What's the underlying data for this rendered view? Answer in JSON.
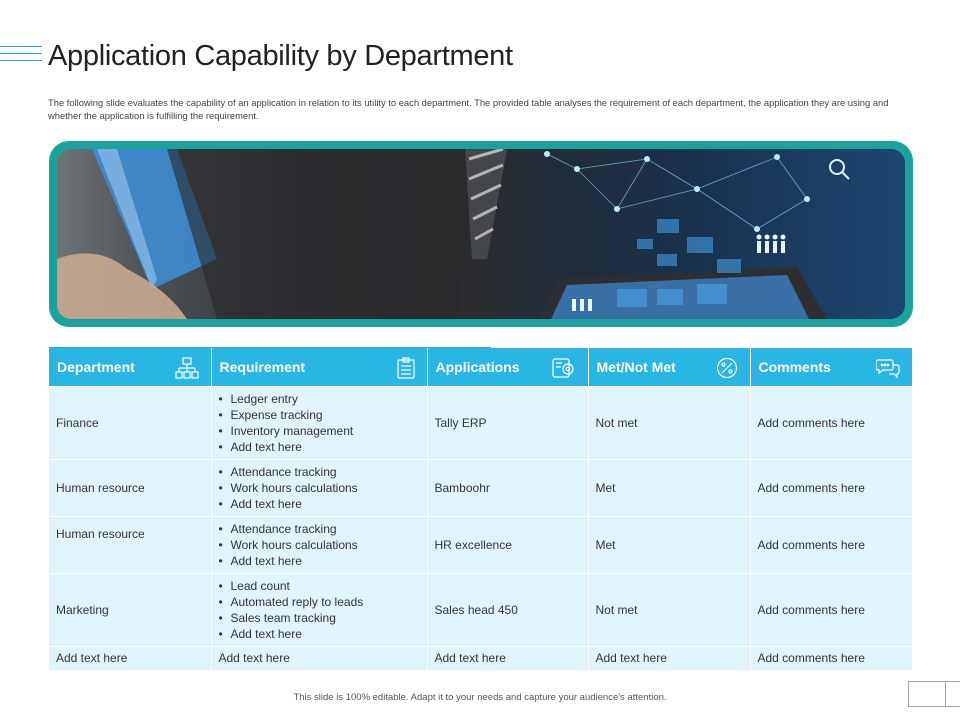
{
  "slide": {
    "title": "Application Capability by Department",
    "description": "The following slide evaluates the capability of an application in relation to its utility to each department. The provided table analyses the requirement of each department, the application they are using and whether the application is fulfilling the requirement.",
    "footer": "This slide is 100% editable. Adapt it to your needs and capture your audience's attention."
  },
  "colors": {
    "accent": "#29b6e3",
    "hero_frame": "#1aa39b",
    "row_fill": "#e2f4fb"
  },
  "table": {
    "headers": [
      {
        "label": "Department",
        "icon": "org-chart-icon"
      },
      {
        "label": "Requirement",
        "icon": "clipboard-icon"
      },
      {
        "label": "Applications",
        "icon": "app-gear-icon"
      },
      {
        "label": "Met/Not Met",
        "icon": "percent-icon"
      },
      {
        "label": "Comments",
        "icon": "chat-bubbles-icon"
      }
    ],
    "rows": [
      {
        "department": "Finance",
        "requirements": [
          "Ledger entry",
          "Expense tracking",
          "Inventory management",
          "Add text here"
        ],
        "application": "Tally ERP",
        "status": "Not met",
        "comment": "Add comments here"
      },
      {
        "department": "Human resource",
        "requirements": [
          "Attendance tracking",
          "Work hours calculations",
          "Add text here"
        ],
        "application": "Bamboohr",
        "status": "Met",
        "comment": "Add comments here"
      },
      {
        "department": "Human resource",
        "requirements": [
          "Attendance tracking",
          "Work hours calculations",
          "Add text here"
        ],
        "application": "HR excellence",
        "status": "Met",
        "comment": "Add comments here"
      },
      {
        "department": "Marketing",
        "requirements": [
          "Lead count",
          "Automated reply to leads",
          "Sales team tracking",
          "Add text here"
        ],
        "application": "Sales head 450",
        "status": "Not met",
        "comment": "Add comments here"
      },
      {
        "department": "Add text here",
        "requirement_text": "Add text here",
        "application": "Add text here",
        "status": "Add text here",
        "comment": "Add comments here"
      }
    ]
  }
}
